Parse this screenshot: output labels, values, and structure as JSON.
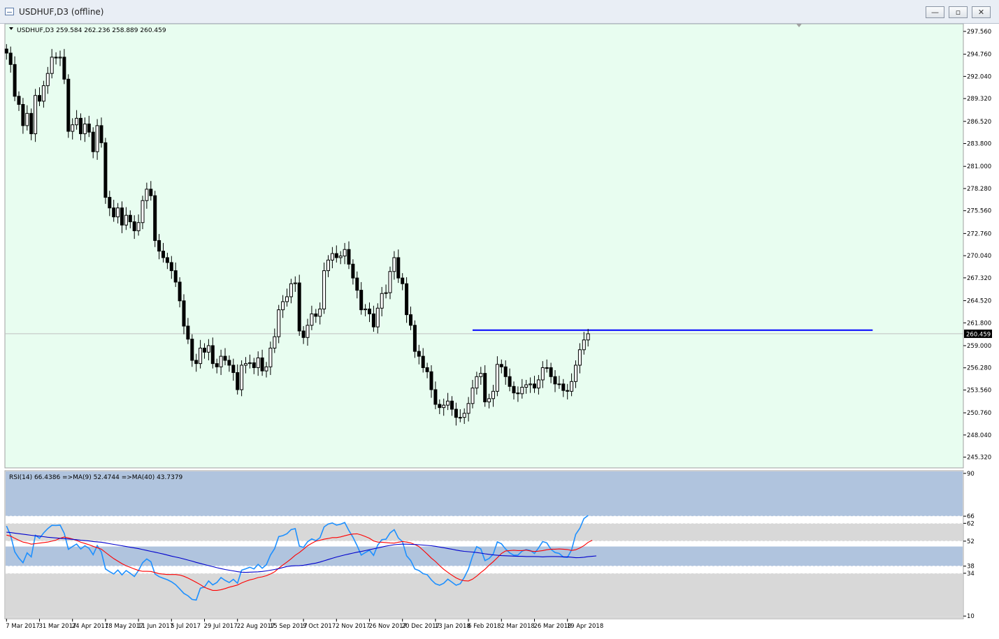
{
  "window": {
    "title": "USDHUF,D3 (offline)",
    "icon": "chart-window-icon",
    "buttons": {
      "minimize": "—",
      "maximize": "▫",
      "close": "✕"
    }
  },
  "colors": {
    "main_bg": "#e8fdf0",
    "rsi_band_high": "#b0c4de",
    "rsi_band_mid": "#b0c4de",
    "rsi_band_gray": "#d8d8d8",
    "rsi_line": "#1e90ff",
    "ma9_line": "#ff0000",
    "ma40_line": "#0000cd",
    "hline": "#0000ff",
    "candle": "#000000",
    "price_label_bg": "#000000"
  },
  "chart_data": [
    {
      "type": "candlestick",
      "symbol_label": "USDHUF,D3  259.584 262.236 258.889 260.459",
      "ylim": [
        244.0,
        298.5
      ],
      "y_ticks": [
        "297.560",
        "294.760",
        "292.040",
        "289.320",
        "286.520",
        "283.800",
        "281.000",
        "278.280",
        "275.560",
        "272.760",
        "270.040",
        "267.320",
        "264.520",
        "261.800",
        "259.000",
        "256.280",
        "253.560",
        "250.760",
        "248.040",
        "245.320"
      ],
      "y_tick_values": [
        297.56,
        294.76,
        292.04,
        289.32,
        286.52,
        283.8,
        281.0,
        278.28,
        275.56,
        272.76,
        270.04,
        267.32,
        264.52,
        261.8,
        259.0,
        256.28,
        253.56,
        250.76,
        248.04,
        245.32
      ],
      "last_price_label": "260.459",
      "last_price": 260.459,
      "horizontal_line_level": 260.9,
      "hline_start_index": 113,
      "hline_end_index": 210,
      "x_labels": [
        "7 Mar 2017",
        "31 Mar 2017",
        "24 Apr 2017",
        "18 May 2017",
        "11 Jun 2017",
        "5 Jul 2017",
        "29 Jul 2017",
        "22 Aug 2017",
        "15 Sep 2017",
        "9 Oct 2017",
        "2 Nov 2017",
        "26 Nov 2017",
        "20 Dec 2017",
        "13 Jan 2018",
        "6 Feb 2018",
        "2 Mar 2018",
        "26 Mar 2018",
        "19 Apr 2018"
      ],
      "x_label_indices": [
        0,
        8,
        16,
        24,
        32,
        40,
        48,
        56,
        64,
        72,
        80,
        88,
        96,
        104,
        112,
        120,
        128,
        136
      ],
      "closes": [
        294.9,
        293.5,
        289.6,
        288.6,
        286.0,
        287.5,
        285.0,
        289.7,
        289.0,
        290.9,
        292.4,
        294.4,
        294.3,
        294.4,
        291.7,
        285.3,
        286.1,
        286.9,
        285.0,
        286.2,
        285.2,
        282.8,
        286.0,
        283.9,
        277.2,
        275.9,
        274.8,
        275.9,
        273.8,
        275.0,
        274.2,
        273.1,
        274.1,
        276.8,
        278.2,
        277.4,
        271.9,
        270.6,
        269.8,
        269.2,
        268.2,
        266.8,
        264.5,
        261.4,
        259.8,
        257.2,
        256.8,
        258.7,
        258.2,
        259.0,
        256.8,
        256.4,
        257.7,
        257.2,
        256.6,
        255.7,
        253.6,
        256.6,
        256.8,
        256.9,
        256.3,
        257.5,
        255.9,
        256.4,
        258.7,
        260.1,
        263.4,
        264.4,
        265.0,
        266.6,
        266.7,
        260.8,
        260.0,
        261.5,
        262.9,
        262.6,
        263.5,
        268.2,
        269.5,
        270.3,
        269.8,
        270.0,
        270.8,
        269.0,
        267.3,
        265.8,
        263.4,
        263.5,
        262.9,
        261.3,
        263.6,
        265.4,
        265.5,
        268.1,
        269.8,
        267.3,
        266.6,
        262.8,
        261.5,
        258.3,
        257.7,
        256.3,
        255.8,
        253.6,
        251.8,
        251.4,
        251.7,
        252.2,
        251.2,
        250.2,
        250.2,
        250.7,
        251.9,
        253.8,
        255.2,
        255.6,
        252.1,
        252.5,
        253.4,
        256.7,
        256.4,
        255.2,
        254.0,
        253.2,
        253.1,
        253.9,
        254.2,
        254.3,
        253.8,
        254.8,
        256.3,
        256.3,
        255.2,
        254.3,
        254.3,
        253.5,
        253.4,
        254.6,
        256.6,
        258.5,
        259.7,
        260.459
      ],
      "rsi_panel": {
        "label": "RSI(14) 66.4386  =>MA(9) 52.4744  =>MA(40) 43.7379",
        "ylim": [
          8.5,
          91.5
        ],
        "y_ticks": [
          "90",
          "66",
          "62",
          "52",
          "38",
          "34",
          "10"
        ],
        "y_tick_values": [
          90,
          66,
          62,
          52,
          38,
          34,
          10
        ],
        "band_high": [
          66,
          90
        ],
        "band_mid": [
          38,
          49
        ],
        "gray_bands": [
          [
            52,
            62
          ],
          [
            10,
            34
          ]
        ],
        "dashed_levels": [
          66,
          62,
          52,
          38,
          34
        ],
        "series": [
          {
            "name": "RSI(14)",
            "values": [
              60.5,
              55.2,
              46.0,
              42.5,
              39.9,
              45.4,
              43.2,
              55.3,
              53.6,
              56.6,
              59.0,
              60.9,
              60.8,
              61.0,
              56.4,
              47.4,
              49.0,
              50.4,
              47.6,
              49.4,
              48.0,
              44.4,
              49.5,
              45.9,
              36.4,
              34.9,
              33.6,
              35.8,
              33.1,
              35.5,
              34.0,
              32.2,
              35.5,
              39.9,
              42.0,
              40.5,
              33.6,
              32.1,
              31.2,
              30.4,
              29.2,
              27.6,
              25.2,
              22.7,
              21.4,
              19.3,
              19.0,
              25.6,
              26.3,
              29.7,
              27.5,
              28.8,
              31.6,
              30.0,
              28.8,
              30.6,
              28.4,
              35.7,
              36.5,
              37.4,
              36.4,
              39.0,
              36.8,
              38.8,
              44.2,
              47.8,
              54.6,
              55.1,
              56.2,
              58.5,
              59.0,
              49.2,
              48.5,
              51.7,
              53.3,
              52.3,
              53.9,
              60.0,
              61.6,
              62.2,
              61.0,
              61.5,
              62.5,
              58.0,
              54.2,
              49.5,
              44.2,
              45.6,
              46.9,
              44.0,
              49.8,
              52.8,
              53.1,
              56.6,
              58.4,
              53.8,
              51.7,
              43.8,
              41.1,
              36.4,
              35.5,
              33.8,
              33.2,
              30.3,
              28.1,
              27.3,
              28.4,
              30.7,
              29.0,
              27.3,
              28.1,
              31.7,
              36.4,
              43.6,
              48.9,
              47.6,
              41.1,
              42.3,
              44.7,
              51.6,
              50.5,
              47.6,
              45.4,
              44.1,
              44.2,
              46.4,
              47.3,
              46.8,
              45.1,
              48.2,
              51.8,
              51.0,
              47.4,
              45.6,
              45.1,
              43.1,
              42.9,
              47.1,
              55.8,
              59.2,
              64.7,
              66.4
            ]
          },
          {
            "name": "MA(9)",
            "values": [
              55.4,
              54.8,
              53.6,
              52.5,
              51.5,
              51.0,
              50.3,
              50.6,
              50.9,
              51.2,
              51.5,
              52.0,
              52.6,
              53.6,
              54.3,
              53.8,
              53.2,
              52.4,
              51.4,
              50.7,
              50.0,
              49.1,
              48.3,
              47.5,
              45.7,
              43.9,
              42.2,
              40.8,
              39.4,
              38.2,
              37.3,
              36.4,
              35.6,
              35.1,
              35.1,
              35.0,
              34.4,
              33.8,
              33.5,
              33.3,
              33.3,
              33.3,
              33.0,
              32.3,
              31.3,
              30.1,
              28.9,
              27.6,
              26.1,
              25.2,
              24.4,
              24.4,
              24.8,
              25.4,
              26.2,
              26.8,
              27.4,
              28.6,
              29.5,
              30.3,
              30.8,
              31.6,
              32.0,
              32.6,
              33.6,
              34.8,
              36.8,
              38.6,
              40.3,
              42.1,
              44.1,
              45.6,
              47.5,
              49.4,
              50.8,
              52.0,
              52.5,
              53.1,
              53.5,
              54.0,
              54.0,
              54.4,
              55.0,
              55.6,
              56.0,
              56.1,
              55.5,
              54.6,
              53.6,
              52.1,
              51.5,
              51.4,
              51.2,
              51.0,
              50.9,
              51.4,
              51.8,
              51.5,
              51.0,
              50.1,
              49.0,
              46.9,
              44.8,
              42.5,
              40.6,
              38.3,
              36.2,
              34.5,
              32.9,
              31.4,
              30.4,
              29.8,
              29.7,
              30.7,
              32.4,
              34.4,
              36.2,
              38.5,
              40.5,
              42.7,
              45.1,
              46.5,
              46.7,
              46.9,
              46.7,
              46.7,
              47.0,
              46.5,
              46.2,
              46.4,
              46.7,
              47.2,
              47.5,
              47.5,
              47.6,
              47.5,
              47.3,
              46.8,
              47.2,
              48.2,
              49.5,
              51.3,
              52.5
            ]
          },
          {
            "name": "MA(40)",
            "values": [
              57.0,
              56.8,
              56.5,
              56.2,
              55.9,
              55.6,
              55.3,
              55.0,
              54.8,
              54.5,
              54.2,
              54.0,
              53.8,
              53.6,
              53.4,
              53.2,
              53.0,
              52.8,
              52.5,
              52.3,
              52.1,
              51.8,
              51.6,
              51.4,
              51.0,
              50.6,
              50.2,
              49.8,
              49.4,
              49.0,
              48.6,
              48.2,
              47.8,
              47.3,
              46.8,
              46.3,
              45.8,
              45.3,
              44.8,
              44.2,
              43.6,
              43.1,
              42.6,
              42.0,
              41.4,
              40.8,
              40.1,
              39.5,
              38.9,
              38.3,
              37.7,
              37.1,
              36.6,
              36.1,
              35.7,
              35.3,
              34.9,
              34.6,
              34.5,
              34.6,
              34.7,
              34.8,
              35.0,
              35.3,
              35.7,
              36.1,
              36.6,
              37.2,
              37.8,
              38.1,
              38.2,
              38.3,
              38.5,
              38.9,
              39.3,
              39.7,
              40.3,
              41.0,
              41.7,
              42.4,
              43.1,
              43.7,
              44.3,
              44.8,
              45.3,
              45.8,
              46.2,
              46.7,
              47.2,
              47.7,
              48.2,
              48.7,
              49.2,
              49.6,
              50.0,
              50.2,
              50.3,
              50.3,
              50.2,
              50.1,
              50.0,
              49.8,
              49.6,
              49.4,
              49.1,
              48.7,
              48.3,
              47.9,
              47.5,
              47.0,
              46.6,
              46.3,
              46.1,
              45.9,
              45.6,
              45.3,
              44.9,
              44.6,
              44.3,
              44.1,
              43.9,
              43.8,
              43.7,
              43.6,
              43.5,
              43.5,
              43.4,
              43.4,
              43.4,
              43.3,
              43.2,
              43.3,
              43.4,
              43.4,
              43.3,
              43.2,
              43.2,
              43.0,
              42.7,
              42.8,
              43.0,
              43.3,
              43.5,
              43.7379
            ]
          }
        ]
      }
    }
  ]
}
